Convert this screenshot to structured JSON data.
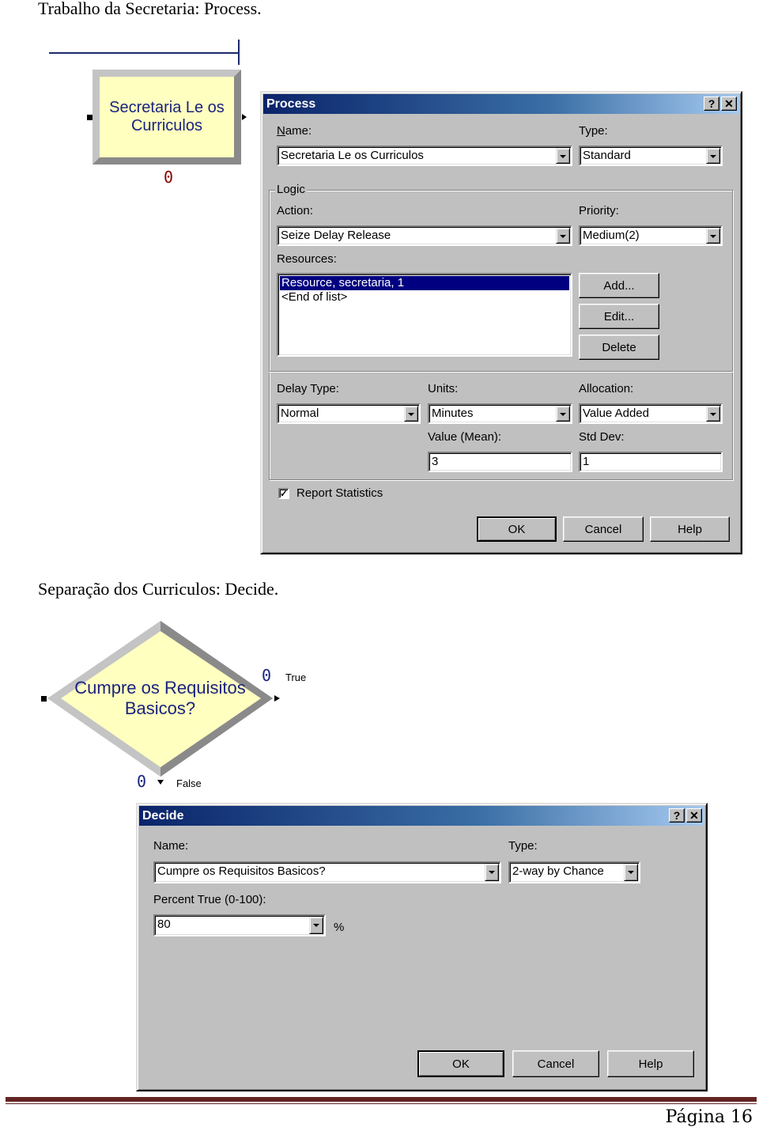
{
  "headings": {
    "process_section": "Trabalho da Secretaria: Process.",
    "decide_section": "Separação dos Curriculos: Decide."
  },
  "process_module": {
    "label_line1": "Secretaria Le os",
    "label_line2": "Curriculos",
    "counter": "0",
    "fill_color": "#ffffc0",
    "text_color": "#1a237e",
    "counter_color": "#8b0000"
  },
  "process_dialog": {
    "title": "Process",
    "help_glyph": "?",
    "close_glyph": "✕",
    "name_label": "Name:",
    "name_value": "Secretaria Le os Curriculos",
    "type_label": "Type:",
    "type_value": "Standard",
    "logic_group": "Logic",
    "action_label": "Action:",
    "action_value": "Seize Delay Release",
    "priority_label": "Priority:",
    "priority_value": "Medium(2)",
    "resources_label": "Resources:",
    "resources": [
      {
        "text": "Resource, secretaria, 1",
        "selected": true
      },
      {
        "text": "<End of list>",
        "selected": false
      }
    ],
    "add_button": "Add...",
    "edit_button": "Edit...",
    "delete_button": "Delete",
    "delay_type_label": "Delay Type:",
    "delay_type_value": "Normal",
    "units_label": "Units:",
    "units_value": "Minutes",
    "allocation_label": "Allocation:",
    "allocation_value": "Value Added",
    "value_mean_label": "Value (Mean):",
    "value_mean_value": "3",
    "std_dev_label": "Std Dev:",
    "std_dev_value": "1",
    "report_statistics_label": "Report Statistics",
    "report_statistics_checked": true,
    "ok_button": "OK",
    "cancel_button": "Cancel",
    "help_button": "Help"
  },
  "decide_module": {
    "label_line1": "Cumpre os Requisitos",
    "label_line2": "Basicos?",
    "true_counter": "0",
    "true_label": "True",
    "false_counter": "0",
    "false_label": "False",
    "fill_color": "#ffffc0",
    "counter_color": "#1a237e"
  },
  "decide_dialog": {
    "title": "Decide",
    "help_glyph": "?",
    "close_glyph": "✕",
    "name_label": "Name:",
    "name_value": "Cumpre os Requisitos Basicos?",
    "type_label": "Type:",
    "type_value": "2-way by Chance",
    "percent_true_label": "Percent True (0-100):",
    "percent_true_value": "80",
    "percent_unit": "%",
    "ok_button": "OK",
    "cancel_button": "Cancel",
    "help_button": "Help"
  },
  "footer": {
    "page_label": "Página 16",
    "rule_color": "#632423"
  }
}
